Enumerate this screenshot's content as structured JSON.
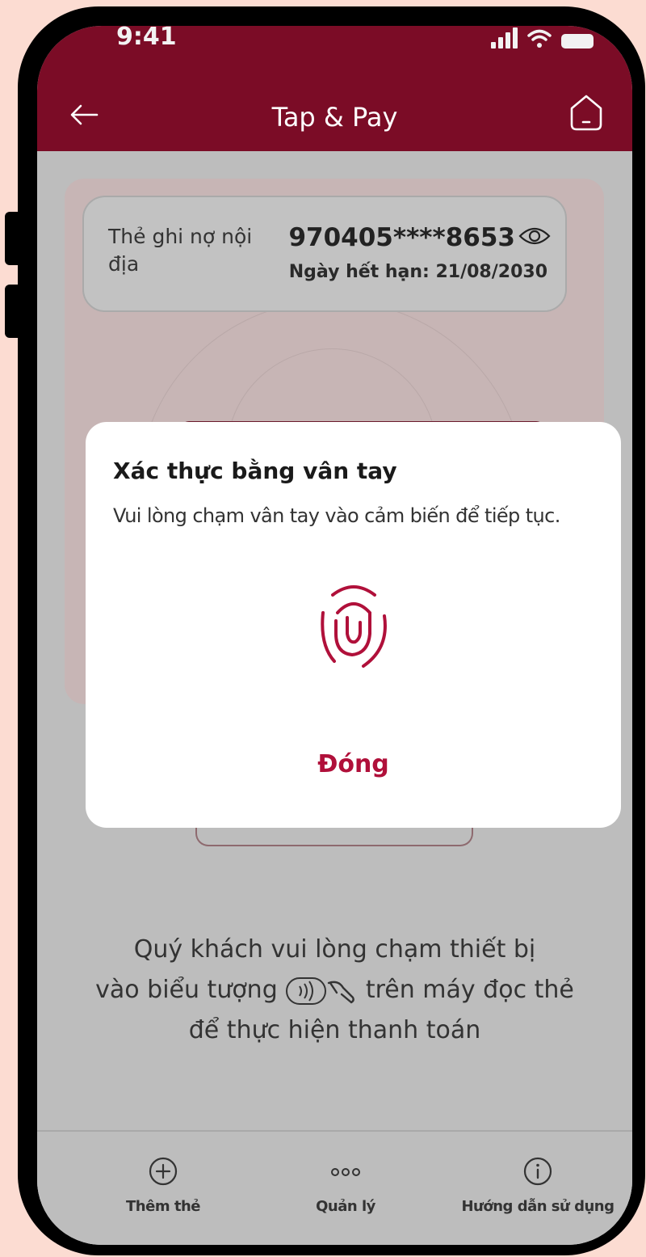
{
  "status_bar": {
    "time": "9:41"
  },
  "header": {
    "title": "Tap & Pay"
  },
  "card": {
    "type_label": "Thẻ ghi nợ nội địa",
    "number": "970405****8653",
    "expiry": "Ngày hết hạn: 21/08/2030"
  },
  "instruction": {
    "line1": "Quý khách vui lòng chạm thiết bị",
    "line2_before": "vào biểu tượng",
    "line2_after": "trên máy đọc thẻ",
    "line3": "để thực hiện thanh toán"
  },
  "bottom_nav": {
    "items": [
      {
        "label": "Thêm thẻ",
        "icon": "plus-circle-icon"
      },
      {
        "label": "Quản lý",
        "icon": "more-dots-icon"
      },
      {
        "label": "Hướng dẫn sử dụng",
        "icon": "info-circle-icon"
      }
    ]
  },
  "modal": {
    "title": "Xác thực bằng vân tay",
    "message": "Vui lòng chạm vân tay vào cảm biến để tiếp tục.",
    "close_label": "Đóng",
    "icon": "fingerprint-icon"
  },
  "colors": {
    "brand": "#7b0c26",
    "accent": "#b0103a",
    "overlay": "#bdbdbd"
  }
}
